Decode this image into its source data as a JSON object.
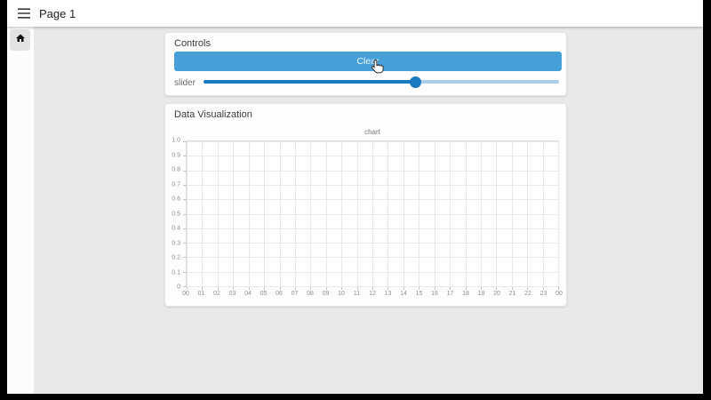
{
  "topbar": {
    "title": "Page 1"
  },
  "sidebar": {
    "items": [
      {
        "icon": "home"
      }
    ]
  },
  "controls": {
    "title": "Controls",
    "clear_button": "Clear",
    "slider": {
      "label": "slider",
      "value_percent": 59.5
    }
  },
  "visualization": {
    "title": "Data Visualization"
  },
  "chart_data": {
    "type": "line",
    "title": "chart",
    "x_tick_labels": [
      "00",
      "01",
      "02",
      "03",
      "04",
      "05",
      "06",
      "07",
      "08",
      "09",
      "10",
      "11",
      "12",
      "13",
      "14",
      "15",
      "16",
      "17",
      "18",
      "19",
      "20",
      "21",
      "22",
      "23",
      "00"
    ],
    "y_tick_labels": [
      "1.0",
      "0.9",
      "0.8",
      "0.7",
      "0.6",
      "0.5",
      "0.4",
      "0.3",
      "0.2",
      "0.1",
      "0"
    ],
    "ylim": [
      0,
      1
    ],
    "grid": true,
    "legend": "none",
    "series": []
  },
  "colors": {
    "button_blue": "#47a1d8",
    "slider_fill_blue": "#1b79c0",
    "slider_track_blue": "#a9cfe8",
    "content_bg": "#e9e9e9",
    "grid": "#e8e8ee"
  },
  "cursor": {
    "icon": "hand-pointer"
  }
}
